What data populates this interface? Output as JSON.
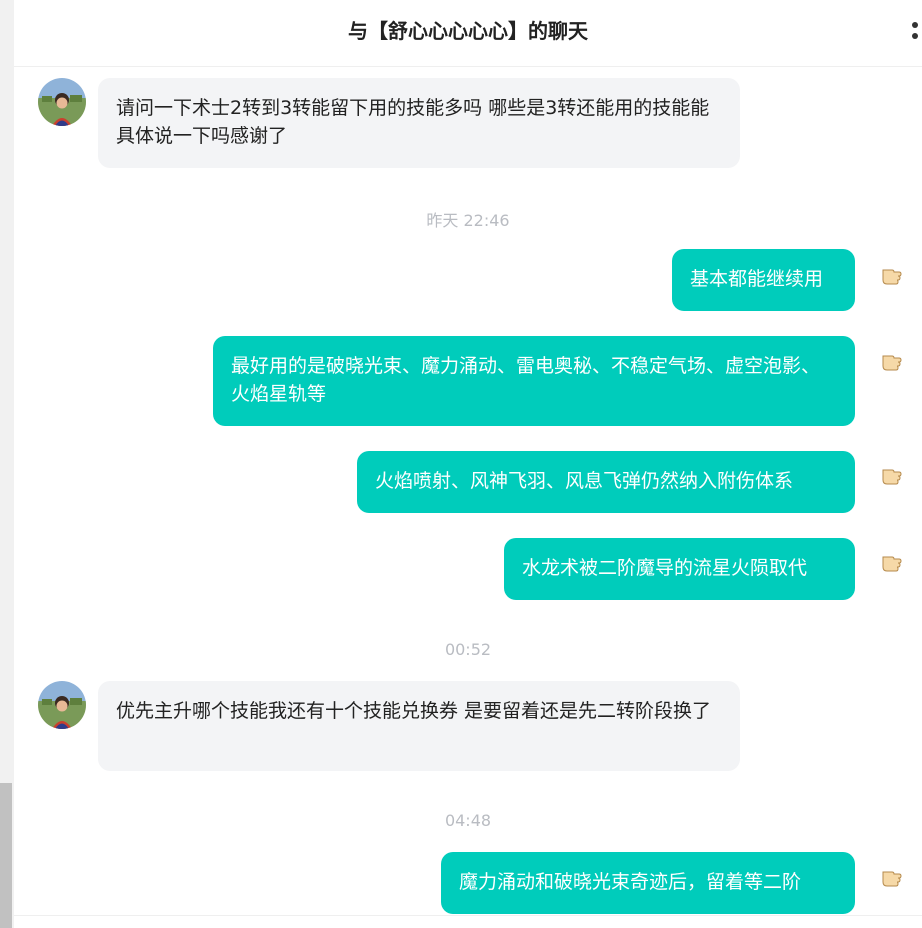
{
  "header": {
    "title": "与【舒心心心心心】的聊天"
  },
  "messages": [
    {
      "text": "请问一下术士2转到3转能留下用的技能多吗 哪些是3转还能用的技能能具体说一下吗感谢了"
    },
    {
      "text": "昨天 22:46"
    },
    {
      "text": "基本都能继续用"
    },
    {
      "text": "最好用的是破晓光束、魔力涌动、雷电奥秘、不稳定气场、虚空泡影、火焰星轨等"
    },
    {
      "text": "火焰喷射、风神飞羽、风息飞弹仍然纳入附伤体系"
    },
    {
      "text": "水龙术被二阶魔导的流星火陨取代"
    },
    {
      "text": "00:52"
    },
    {
      "text": "优先主升哪个技能我还有十个技能兑换券 是要留着还是先二转阶段换了"
    },
    {
      "text": "04:48"
    },
    {
      "text": "魔力涌动和破晓光束奇迹后，留着等二阶"
    }
  ],
  "icons": {
    "more": "more-vertical-icon",
    "avatar": "avatar-photo",
    "hand": "pointing-hand-icon"
  },
  "colors": {
    "outgoing_bubble": "#00ccbb",
    "incoming_bubble": "#f3f4f6",
    "timestamp": "#b9bcc2"
  }
}
